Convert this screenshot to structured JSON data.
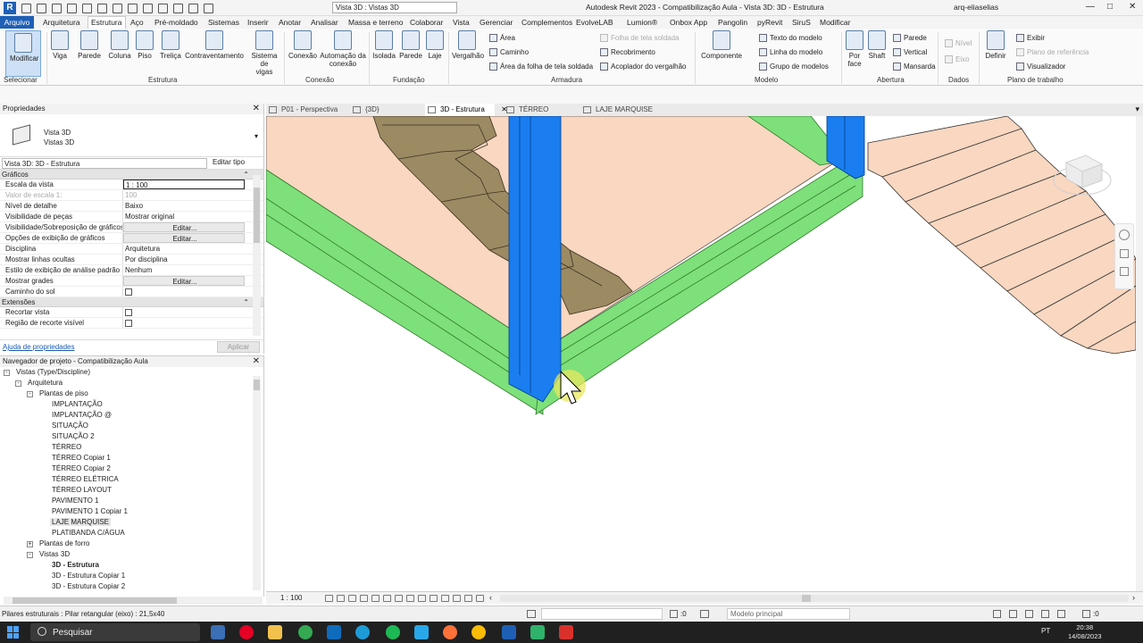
{
  "title_bar": {
    "view_selector": "Vista 3D : Vistas 3D",
    "app_title": "Autodesk Revit 2023 - Compatibilização Aula - Vista 3D: 3D - Estrutura",
    "user": "arq-eliaselias",
    "minimize": "—",
    "maximize": "□",
    "close": "✕"
  },
  "menu": {
    "file": "Arquivo",
    "items": [
      "Arquitetura",
      "Estrutura",
      "Aço",
      "Pré-moldado",
      "Sistemas",
      "Inserir",
      "Anotar",
      "Analisar",
      "Massa e terreno",
      "Colaborar",
      "Vista",
      "Gerenciar",
      "Complementos",
      "EvolveLAB",
      "Lumion®",
      "Onbox App",
      "Pangolin",
      "pyRevit",
      "SiruS",
      "Modificar"
    ],
    "active": "Estrutura"
  },
  "ribbon": {
    "buttons": {
      "modificar": "Modificar",
      "viga": "Viga",
      "parede": "Parede",
      "coluna": "Coluna",
      "piso": "Piso",
      "trelica": "Treliça",
      "contraventamento": "Contraventamento",
      "sistema_vigas_1": "Sistema de",
      "sistema_vigas_2": "vigas",
      "conexao": "Conexão",
      "automacao_1": "Automação da",
      "automacao_2": "conexão",
      "isolada": "Isolada",
      "parede_fund": "Parede",
      "laje": "Laje",
      "vergalhao": "Vergalhão",
      "area": "Área",
      "caminho": "Caminho",
      "area_folha": "Área da folha de tela soldada",
      "folha_tela": "Folha de tela soldada",
      "recobrimento": "Recobrimento",
      "acoplador": "Acoplador do vergalhão",
      "componente": "Componente",
      "texto_modelo": "Texto do modelo",
      "linha_modelo": "Linha do modelo",
      "grupo_modelos": "Grupo de modelos",
      "por_face_1": "Por",
      "por_face_2": "face",
      "shaft": "Shaft",
      "parede_ab": "Parede",
      "vertical": "Vertical",
      "mansarda": "Mansarda",
      "nivel": "Nível",
      "eixo": "Eixo",
      "definir": "Definir",
      "exibir": "Exibir",
      "plano_ref": "Plano de referência",
      "visualizador": "Visualizador"
    },
    "panels": {
      "selecionar": "Selecionar",
      "estrutura": "Estrutura",
      "conexao": "Conexão",
      "fundacao": "Fundação",
      "armadura": "Armadura",
      "modelo": "Modelo",
      "abertura": "Abertura",
      "dados": "Dados",
      "plano_trabalho": "Plano de trabalho"
    }
  },
  "properties": {
    "title": "Propriedades",
    "type_line1": "Vista 3D",
    "type_line2": "Vistas 3D",
    "instance": "Vista 3D: 3D - Estrutura",
    "edit_type": "Editar tipo",
    "section_graphics": "Gráficos",
    "rows": [
      {
        "k": "Escala da vista",
        "v": "1 : 100"
      },
      {
        "k": "Valor de escala    1:",
        "v": "100"
      },
      {
        "k": "Nível de detalhe",
        "v": "Baixo"
      },
      {
        "k": "Visibilidade de peças",
        "v": "Mostrar original"
      },
      {
        "k": "Visibilidade/Sobreposição de gráficos",
        "v": "Editar..."
      },
      {
        "k": "Opções de exibição de gráficos",
        "v": "Editar..."
      },
      {
        "k": "Disciplina",
        "v": "Arquitetura"
      },
      {
        "k": "Mostrar linhas ocultas",
        "v": "Por disciplina"
      },
      {
        "k": "Estilo de exibição de análise padrão",
        "v": "Nenhum"
      },
      {
        "k": "Mostrar grades",
        "v": "Editar..."
      },
      {
        "k": "Caminho do sol",
        "v": ""
      }
    ],
    "section_extents": "Extensões",
    "extent_rows": [
      {
        "k": "Recortar vista",
        "v": ""
      },
      {
        "k": "Região de recorte visível",
        "v": ""
      }
    ],
    "help_link": "Ajuda de propriedades",
    "apply": "Aplicar"
  },
  "browser": {
    "title": "Navegador de projeto - Compatibilização Aula",
    "root": "Vistas (Type/Discipline)",
    "arquitetura": "Arquitetura",
    "plantas_piso": "Plantas de piso",
    "floor_plans": [
      "IMPLANTAÇÃO",
      "IMPLANTAÇÃO @",
      "SITUAÇÃO",
      "SITUAÇÃO 2",
      "TÉRREO",
      "TÉRREO Copiar 1",
      "TÉRREO Copiar 2",
      "TÉRREO ELÉTRICA",
      "TÉRREO LAYOUT",
      "PAVIMENTO 1",
      "PAVIMENTO 1 Copiar 1",
      "LAJE MARQUISE",
      "PLATIBANDA C/ÁGUA"
    ],
    "plantas_forro": "Plantas de forro",
    "vistas_3d": "Vistas 3D",
    "views_3d": [
      "3D - Estrutura",
      "3D - Estrutura Copiar 1",
      "3D - Estrutura Copiar 2"
    ]
  },
  "tabs": [
    "P01 - Perspectiva",
    "{3D}",
    "3D - Estrutura",
    "TÉRREO",
    "LAJE MARQUISE"
  ],
  "active_tab": "3D - Estrutura",
  "view_control": {
    "scale": "1 : 100"
  },
  "status": {
    "message": "Pilares estruturais : Pilar retangular (eixo) : 21,5x40",
    "sel_count": ":0",
    "model": "Modelo principal",
    "filter_count": ":0"
  },
  "taskbar": {
    "search": "Pesquisar",
    "lang": "PT",
    "time": "20:38",
    "date": "14/08/2023"
  },
  "colors": {
    "revit_blue": "#1e5fb6",
    "slab_fill": "#f9d7c0",
    "beam_green": "#7ee07a",
    "column_blue": "#1a7ef0",
    "stair": "#9c8a63"
  }
}
